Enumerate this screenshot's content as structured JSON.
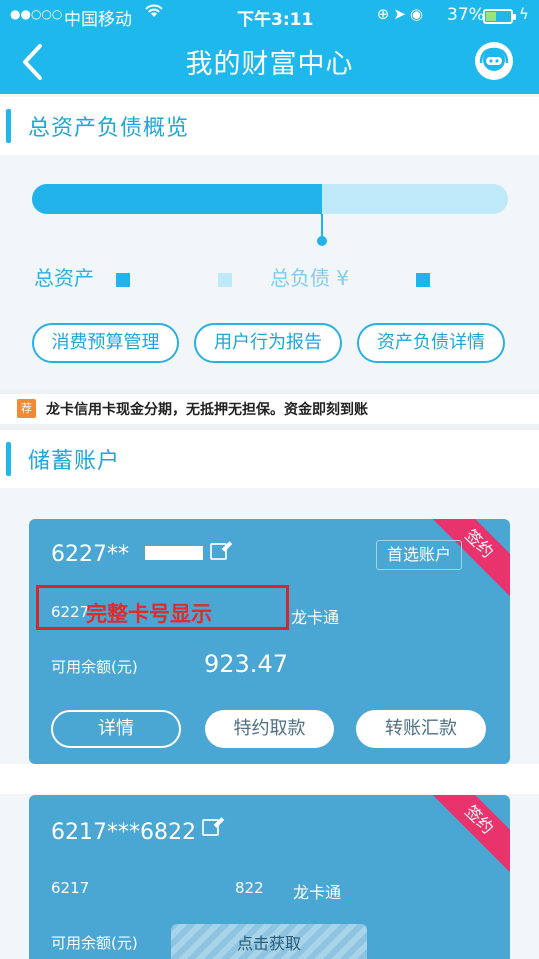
{
  "status_bar": {
    "signal": "●●○○○",
    "carrier": "中国移动",
    "time": "下午3:11",
    "battery_percent": "37%",
    "battery_level": 0.37
  },
  "nav": {
    "title": "我的财富中心",
    "back_icon": "chevron-left-icon",
    "service_icon": "customer-service-icon"
  },
  "overview": {
    "section_title": "总资产负债概览",
    "asset_ratio": 0.61,
    "assets_label": "总资产",
    "liabilities_label": "总负债 ¥",
    "buttons": [
      "消费预算管理",
      "用户行为报告",
      "资产负债详情"
    ],
    "colors": {
      "assets": "#21b3ea",
      "liabilities": "#bfe8f8"
    }
  },
  "promo": {
    "tag": "荐",
    "text": "龙卡信用卡现金分期，无抵押无担保。资金即刻到账"
  },
  "savings": {
    "section_title": "储蓄账户",
    "cards": [
      {
        "number_masked": "6227**",
        "number_full_prefix": "6227",
        "card_type": "龙卡通",
        "primary_label": "首选账户",
        "ribbon": "签约",
        "balance_label": "可用余额(元)",
        "balance": "923.47",
        "buttons": [
          "详情",
          "特约取款",
          "转账汇款"
        ]
      },
      {
        "number_masked": "6217***6822",
        "number_prefix": "6217",
        "number_suffix": "822",
        "card_type": "龙卡通",
        "ribbon": "签约",
        "balance_label": "可用余额(元)",
        "fetch_label": "点击获取"
      }
    ]
  },
  "annotation": {
    "text": "完整卡号显示",
    "color": "#d5262a"
  }
}
